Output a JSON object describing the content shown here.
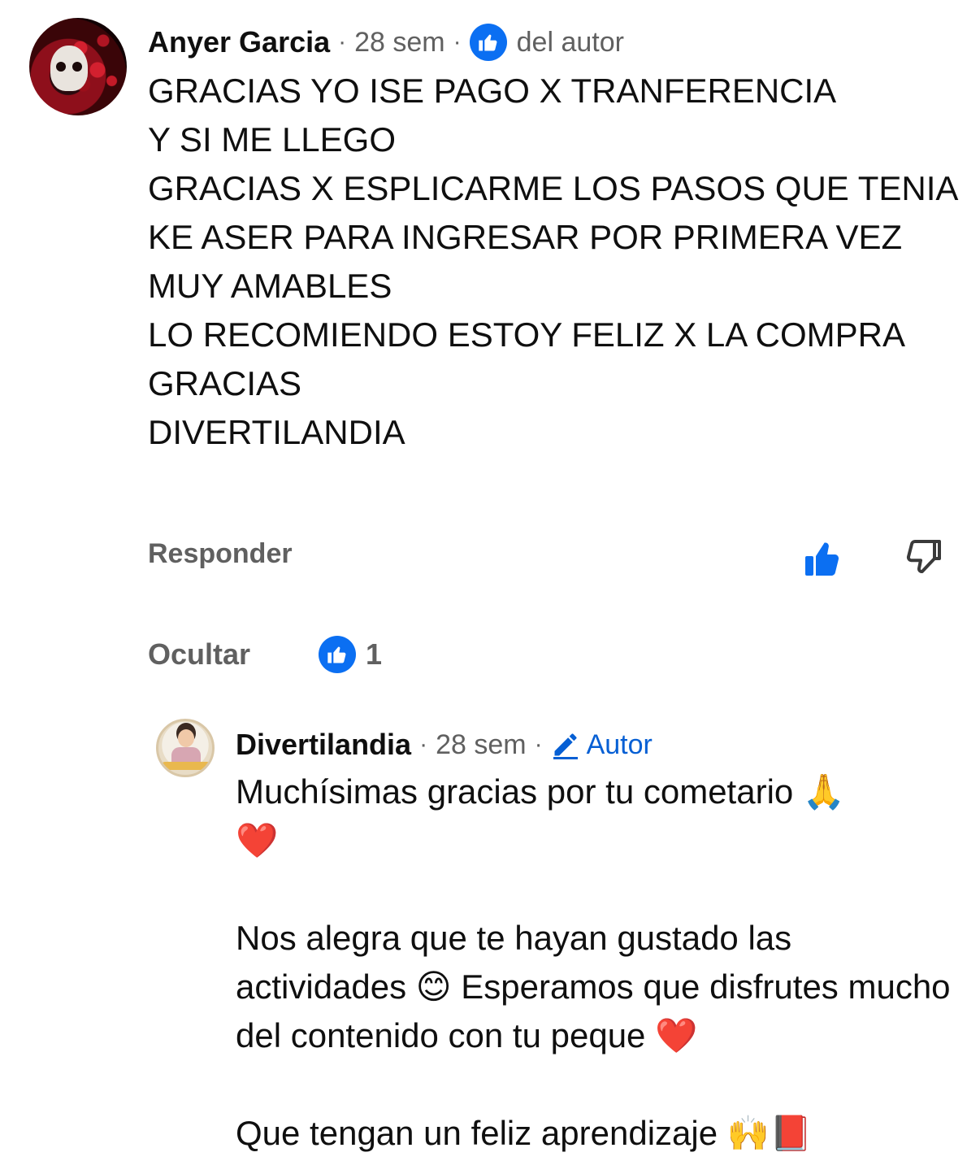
{
  "comment": {
    "author": "Anyer Garcia",
    "time": "28 sem",
    "separator": "·",
    "liked_label": "del autor",
    "text": "GRACIAS YO ISE PAGO X TRANFERENCIA\nY SI ME LLEGO\nGRACIAS X ESPLICARME LOS PASOS QUE TENIA KE ASER PARA INGRESAR POR PRIMERA VEZ\nMUY AMABLES\nLO RECOMIENDO ESTOY FELIZ X LA COMPRA\nGRACIAS\nDIVERTILANDIA",
    "reply_label": "Responder"
  },
  "replies": {
    "hide_label": "Ocultar",
    "like_count": "1"
  },
  "reply": {
    "author": "Divertilandia",
    "time": "28 sem",
    "separator": "·",
    "badge": "Autor",
    "text": "Muchísimas gracias por tu cometario 🙏\n❤️\n\nNos alegra que te hayan gustado las actividades 😊 Esperamos que disfrutes mucho del contenido con tu peque ❤️\n\nQue tengan un feliz aprendizaje 🙌📕"
  },
  "colors": {
    "accent": "#0b6ff2",
    "link": "#065fd4",
    "secondary_text": "#606060"
  },
  "icons": [
    "like-badge-icon",
    "thumbs-up-icon",
    "thumbs-down-icon",
    "pencil-icon"
  ]
}
